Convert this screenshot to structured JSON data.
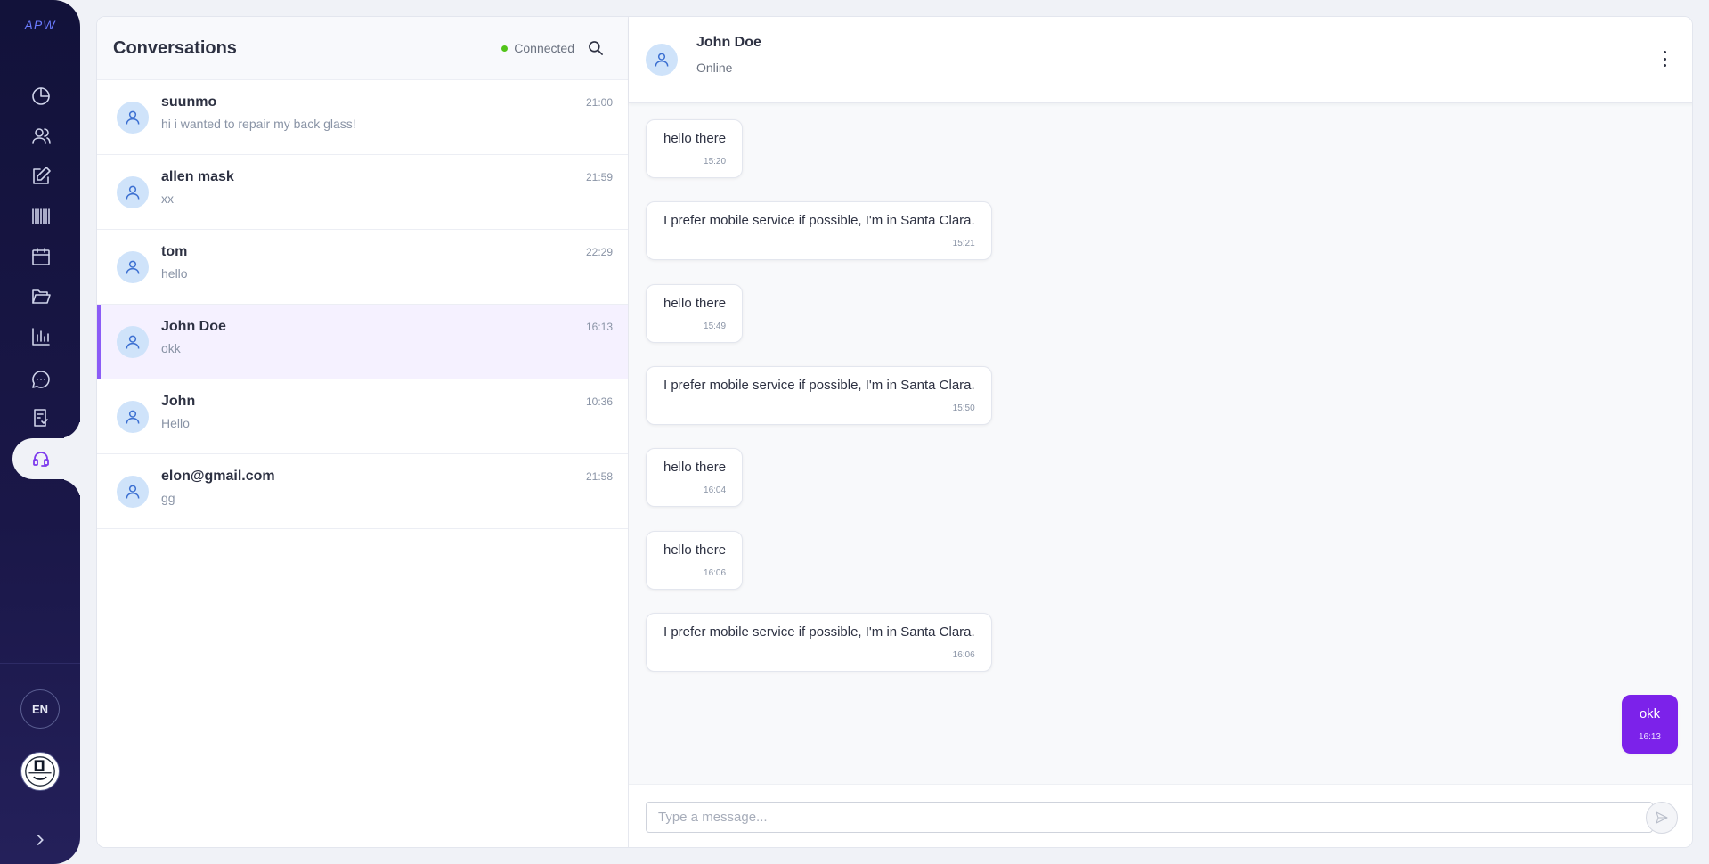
{
  "app": {
    "logo_text": "APW"
  },
  "nav": {
    "items": [
      {
        "icon": "pie-chart-icon"
      },
      {
        "icon": "users-icon"
      },
      {
        "icon": "edit-icon"
      },
      {
        "icon": "barcode-icon"
      },
      {
        "icon": "calendar-icon"
      },
      {
        "icon": "folder-open-icon"
      },
      {
        "icon": "bar-chart-icon"
      },
      {
        "icon": "chat-bubble-icon"
      },
      {
        "icon": "invoice-icon"
      },
      {
        "icon": "support-headset-icon",
        "active": true
      }
    ],
    "language": "EN",
    "expand_icon": "chevron-right-icon"
  },
  "conversations": {
    "title": "Conversations",
    "status": "Connected",
    "status_color": "#52c41a",
    "accent_color": "#8b5cf6",
    "items": [
      {
        "name": "suunmo",
        "preview": "hi i wanted to repair my back glass!",
        "time": "21:00"
      },
      {
        "name": "allen mask",
        "preview": "xx",
        "time": "21:59"
      },
      {
        "name": "tom",
        "preview": "hello",
        "time": "22:29"
      },
      {
        "name": "John Doe",
        "preview": "okk",
        "time": "16:13",
        "active": true
      },
      {
        "name": "John",
        "preview": "Hello",
        "time": "10:36"
      },
      {
        "name": "elon@gmail.com",
        "preview": "gg",
        "time": "21:58"
      }
    ]
  },
  "chat": {
    "contact_name": "John Doe",
    "contact_status": "Online",
    "outgoing_color": "#7c22ea",
    "messages": [
      {
        "text": "hello there",
        "time": "15:20",
        "mine": false
      },
      {
        "text": "I prefer mobile service if possible, I'm in Santa Clara.",
        "time": "15:21",
        "mine": false
      },
      {
        "text": "hello there",
        "time": "15:49",
        "mine": false
      },
      {
        "text": "I prefer mobile service if possible, I'm in Santa Clara.",
        "time": "15:50",
        "mine": false
      },
      {
        "text": "hello there",
        "time": "16:04",
        "mine": false
      },
      {
        "text": "hello there",
        "time": "16:06",
        "mine": false
      },
      {
        "text": "I prefer mobile service if possible, I'm in Santa Clara.",
        "time": "16:06",
        "mine": false
      },
      {
        "text": "okk",
        "time": "16:13",
        "mine": true
      }
    ],
    "composer": {
      "placeholder": "Type a message...",
      "value": ""
    }
  }
}
